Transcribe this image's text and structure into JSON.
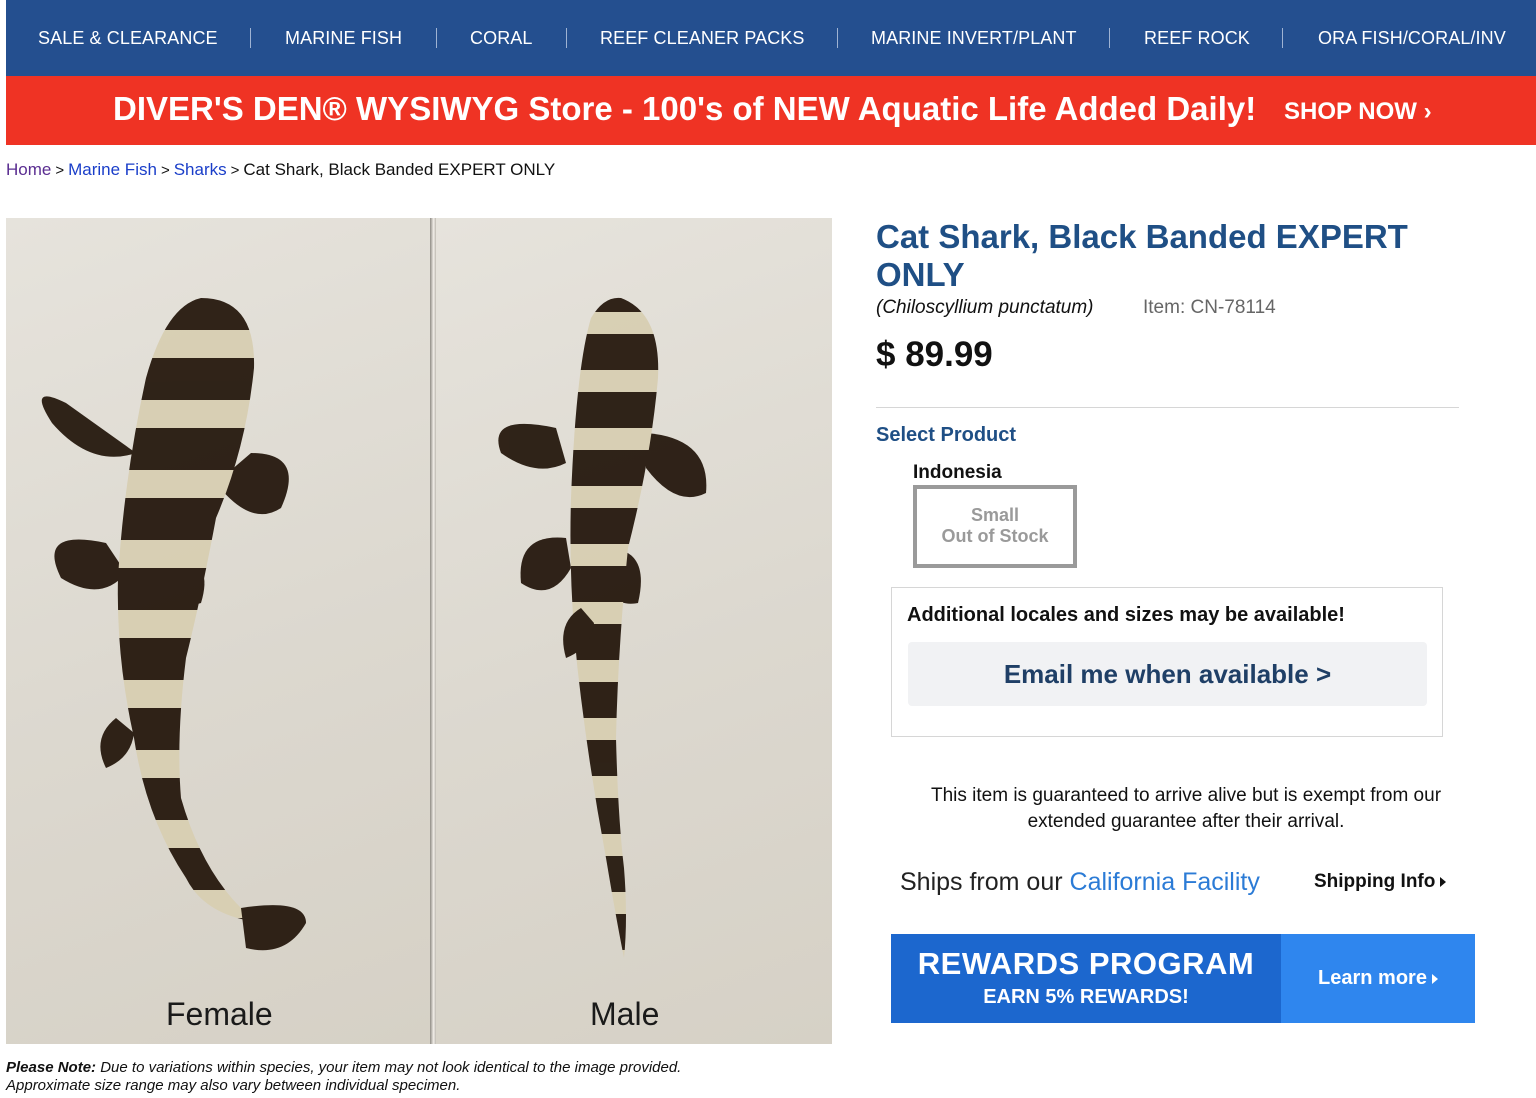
{
  "nav": {
    "items": [
      {
        "label": "SALE & CLEARANCE"
      },
      {
        "label": "MARINE FISH"
      },
      {
        "label": "CORAL"
      },
      {
        "label": "REEF CLEANER PACKS"
      },
      {
        "label": "MARINE INVERT/PLANT"
      },
      {
        "label": "REEF ROCK"
      },
      {
        "label": "ORA FISH/CORAL/INV"
      }
    ]
  },
  "promo": {
    "text": "DIVER'S DEN® WYSIWYG Store - 100's of NEW Aquatic Life Added Daily!",
    "cta": "SHOP NOW ›"
  },
  "breadcrumb": {
    "home": "Home",
    "sep": ">",
    "marine_fish": "Marine Fish",
    "sharks": "Sharks",
    "current": "Cat Shark, Black Banded EXPERT ONLY"
  },
  "image": {
    "left_label": "Female",
    "right_label": "Male"
  },
  "note": {
    "bold": "Please Note:",
    "line1": " Due to variations within species, your item may not look identical to the image provided.",
    "line2": "Approximate size range may also vary between individual specimen."
  },
  "product": {
    "title": "Cat Shark, Black Banded EXPERT ONLY",
    "scientific_name": "(Chiloscyllium punctatum)",
    "item_number": "Item: CN-78114",
    "price": "$ 89.99",
    "select_label": "Select Product",
    "locale": "Indonesia",
    "size": "Small",
    "stock_status": "Out of Stock",
    "availability_text": "Additional locales and sizes may be available!",
    "email_button": "Email me when available >",
    "guarantee_text": "This item is guaranteed to arrive alive but is exempt from our extended guarantee after their arrival.",
    "ships_from_prefix": "Ships from our ",
    "ships_from_facility": "California Facility",
    "shipping_info": "Shipping Info"
  },
  "rewards": {
    "title": "REWARDS PROGRAM",
    "subtitle": "EARN 5% REWARDS!",
    "learn_more": "Learn more"
  },
  "colors": {
    "nav_bg": "#244f8f",
    "promo_bg": "#ef3324",
    "title_blue": "#1f4f85",
    "link_blue": "#1a3ec9",
    "rewards_blue": "#1c67ce",
    "rewards_light": "#2f86ee"
  }
}
